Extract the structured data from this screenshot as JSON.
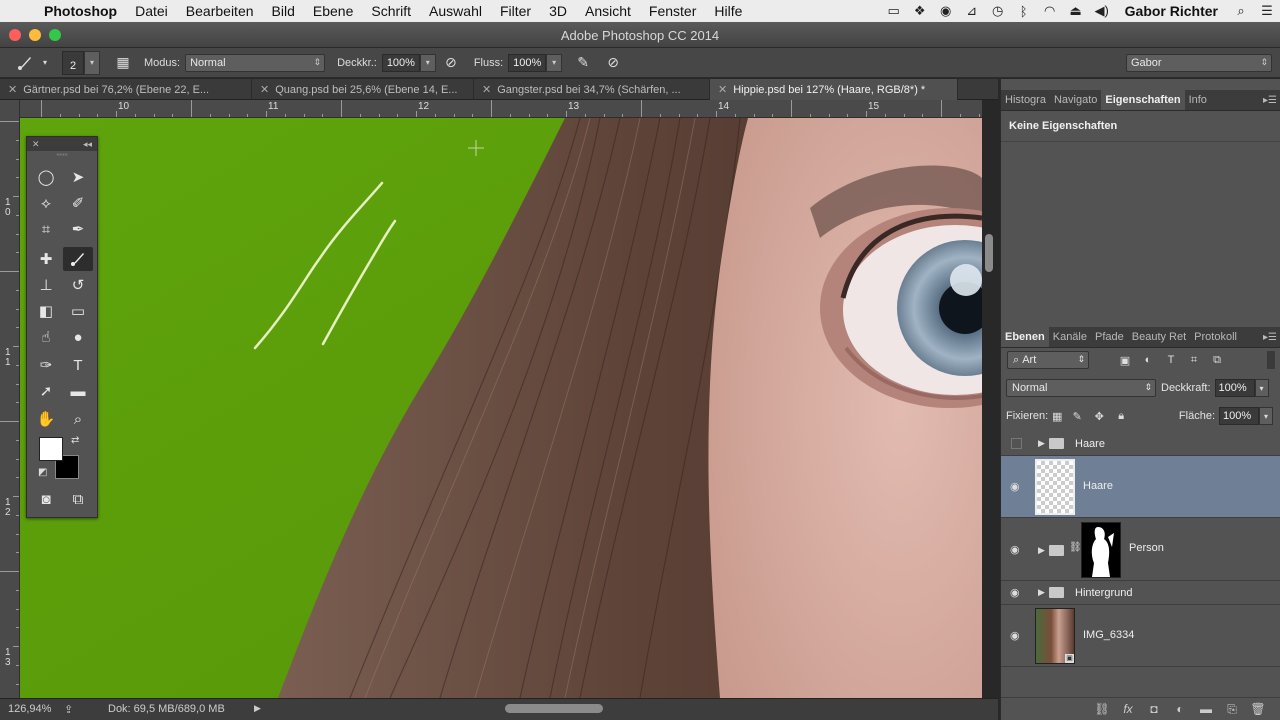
{
  "menubar": {
    "apple": "",
    "app": "Photoshop",
    "items": [
      "Datei",
      "Bearbeiten",
      "Bild",
      "Ebene",
      "Schrift",
      "Auswahl",
      "Filter",
      "3D",
      "Ansicht",
      "Fenster",
      "Hilfe"
    ],
    "user": "Gabor Richter",
    "status_icons": [
      "display-icon",
      "dropbox-icon",
      "evernote-icon",
      "airplay-icon",
      "time-machine-icon",
      "bluetooth-icon",
      "wifi-icon",
      "eject-icon",
      "volume-icon"
    ]
  },
  "window": {
    "title": "Adobe Photoshop CC 2014",
    "traffic_colors": [
      "#fc605c",
      "#fdbc40",
      "#34c84a"
    ]
  },
  "options": {
    "brush_size": "2",
    "mode_label": "Modus:",
    "mode_value": "Normal",
    "opacity_label": "Deckkr.:",
    "opacity_value": "100%",
    "flow_label": "Fluss:",
    "flow_value": "100%",
    "workspace": "Gabor"
  },
  "doc_tabs": [
    {
      "label": "Gärtner.psd bei 76,2% (Ebene 22, E...",
      "active": false
    },
    {
      "label": "Quang.psd bei 25,6% (Ebene 14, E...",
      "active": false
    },
    {
      "label": "Gangster.psd bei 34,7% (Schärfen, ...",
      "active": false
    },
    {
      "label": "Hippie.psd bei 127% (Haare, RGB/8*) *",
      "active": true
    }
  ],
  "rulers": {
    "top": [
      "10",
      "11",
      "12",
      "13",
      "14",
      "15"
    ],
    "left": [
      "1\n0",
      "1\n1",
      "1\n2",
      "1\n3"
    ]
  },
  "canvas": {
    "green": "#5b9c0a",
    "hair": "#6b4e42",
    "skin": "#d9b0a4"
  },
  "status": {
    "zoom": "126,94%",
    "doc": "Dok: 69,5 MB/689,0 MB"
  },
  "properties_panel": {
    "tabs": [
      "Histogra",
      "Navigato",
      "Eigenschaften",
      "Info"
    ],
    "active_tab": "Eigenschaften",
    "empty_label": "Keine Eigenschaften"
  },
  "layers_panel": {
    "tabs": [
      "Ebenen",
      "Kanäle",
      "Pfade",
      "Beauty Ret",
      "Protokoll"
    ],
    "active_tab": "Ebenen",
    "filter": "Art",
    "blend_mode": "Normal",
    "opacity_label": "Deckkraft:",
    "opacity_value": "100%",
    "lock_label": "Fixieren:",
    "fill_label": "Fläche:",
    "fill_value": "100%",
    "layers": [
      {
        "name": "Haare",
        "type": "group",
        "visible": false
      },
      {
        "name": "Haare",
        "type": "layer",
        "visible": true,
        "selected": true
      },
      {
        "name": "Person",
        "type": "group-masked",
        "visible": true
      },
      {
        "name": "Hintergrund",
        "type": "group",
        "visible": true
      },
      {
        "name": "IMG_6334",
        "type": "smart-object",
        "visible": true
      }
    ],
    "selected_color": "#6f7f96"
  }
}
